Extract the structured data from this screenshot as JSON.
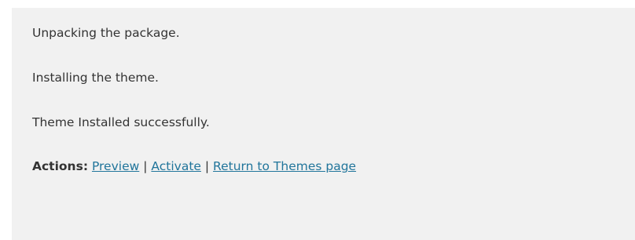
{
  "messages": [
    "Unpacking the package.",
    "Installing the theme.",
    "Theme Installed successfully."
  ],
  "actions": {
    "label": "Actions:",
    "separator": "|",
    "links": [
      "Preview",
      "Activate",
      "Return to Themes page"
    ]
  },
  "colors": {
    "panel_background": "#f1f1f1",
    "text": "#333333",
    "link": "#21759b"
  }
}
